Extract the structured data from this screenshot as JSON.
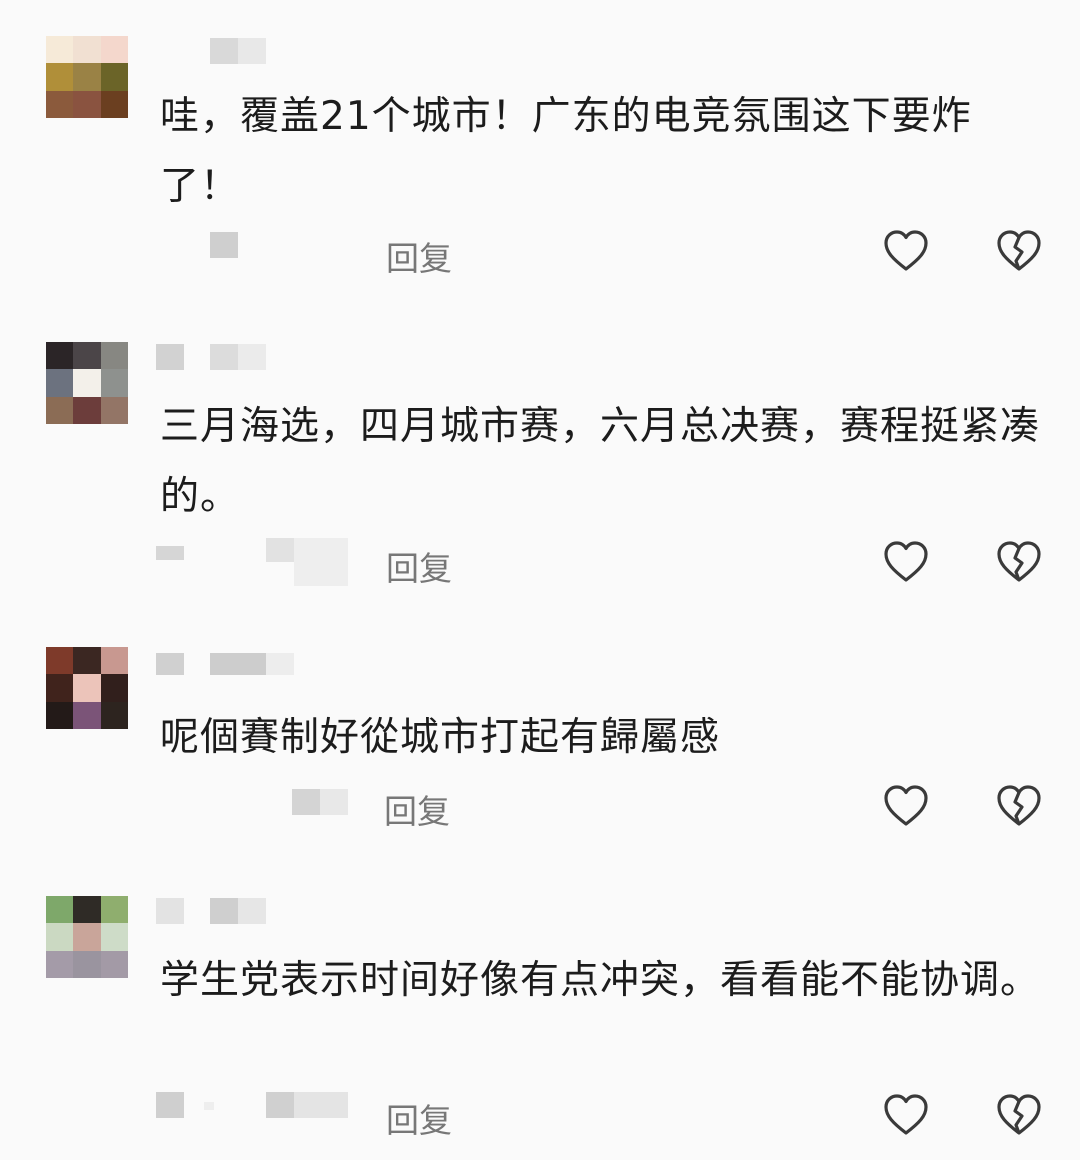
{
  "comments": [
    {
      "text": "哇，覆盖21个城市！广东的电竞氛围这下要炸了！",
      "reply_label": "回复",
      "avatar_colors": [
        "#f6ead8",
        "#f1e0d2",
        "#f4d7cc",
        "#b08f39",
        "#9a8245",
        "#6b6428",
        "#8b5a3c",
        "#8a5340",
        "#6b3f20"
      ]
    },
    {
      "text": "三月海选，四月城市赛，六月总决赛，赛程挺紧凑的。",
      "reply_label": "回复",
      "avatar_colors": [
        "#2b2527",
        "#4b4548",
        "#878782",
        "#6c727f",
        "#f3f0ea",
        "#8e918e",
        "#8b6c55",
        "#6c3d3b",
        "#937566"
      ]
    },
    {
      "text": "呢個賽制好從城市打起有歸屬感",
      "reply_label": "回复",
      "avatar_colors": [
        "#7e3a2a",
        "#3b2722",
        "#c89890",
        "#40231c",
        "#ecc4ba",
        "#311f1c",
        "#231a18",
        "#7b5478",
        "#2d241f"
      ]
    },
    {
      "text": "学生党表示时间好像有点冲突，看看能不能协调。",
      "reply_label": "回复",
      "avatar_colors": [
        "#7ea86a",
        "#2f2b26",
        "#8fae6e",
        "#cbd9c2",
        "#c9a59a",
        "#cedcc8",
        "#a49ba8",
        "#9a949f",
        "#a39aa6"
      ]
    }
  ],
  "icons": {
    "like": "heart-outline",
    "dislike": "broken-heart-outline"
  }
}
